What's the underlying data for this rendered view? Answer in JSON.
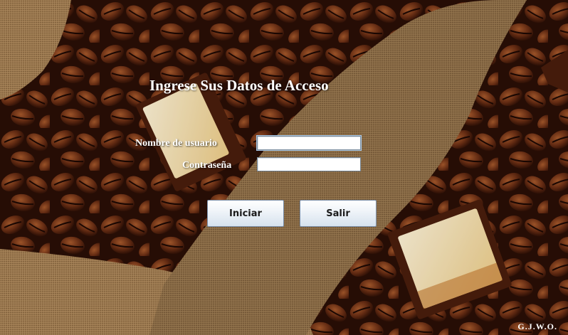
{
  "login": {
    "title": "Ingrese Sus Datos de Acceso",
    "username_label": "Nombre de usuario",
    "username_value": "",
    "password_label": "Contraseña",
    "password_value": "",
    "login_button": "Iniciar",
    "exit_button": "Salir"
  },
  "footer": {
    "credit": "G.J.W.O."
  },
  "colors": {
    "label_text": "#ffffff",
    "button_gradient_top": "#ffffff",
    "button_gradient_bottom": "#d6e2ee",
    "field_border": "#7a8a99"
  },
  "background": {
    "description_icon": "coffee-beans-chocolate-burlap"
  }
}
